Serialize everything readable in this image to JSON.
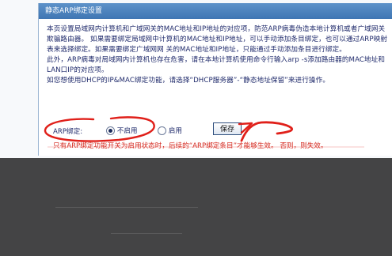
{
  "panel": {
    "title": "静态ARP绑定设置"
  },
  "description": {
    "p1": "本页设置局域网内计算机和广域网关的MAC地址和IP地址的对应项，防范ARP病毒伪造本地计算机或者广域网关欺骗路由器。 如果需要绑定局域网中计算机的MAC地址和IP地址，可以手动添加条目绑定，也可以通过ARP映射表来选择绑定。如果需要绑定广域网网 关的MAC地址和IP地址，只能通过手动添加条目进行绑定。",
    "p2": "此外，ARP病毒对局域网内计算机也存在危害，请在本地计算机使用命令行输入arp -s添加路由器的MAC地址和LAN口IP的对应项。",
    "p3": "如您想使用DHCP的IP&MAC绑定功能，请选择“DHCP服务器”-“静态地址保留”来进行操作。"
  },
  "controls": {
    "arp_label": "ARP绑定:",
    "option_disable": "不启用",
    "option_enable": "启用",
    "selected": "不启用",
    "save_label": "保存",
    "warning": "只有ARP绑定功能开关为启用状态时，后续的“ARP绑定条目”才能够生效。 否则，则失效。"
  },
  "colors": {
    "header_bg": "#3f76b3",
    "text": "#1f2a6b",
    "warning": "#d42a20",
    "annotation": "#e0201a",
    "dark_area": "#444445"
  }
}
